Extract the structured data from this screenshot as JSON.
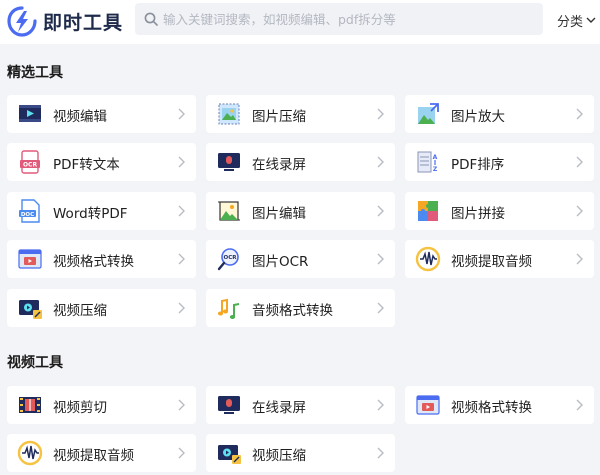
{
  "header": {
    "brand": "即时工具",
    "search_placeholder": "输入关键词搜索，如视频编辑、pdf拆分等",
    "category_label": "分类"
  },
  "sections": [
    {
      "title": "精选工具",
      "items": [
        {
          "label": "视频编辑",
          "icon": "video-edit-icon"
        },
        {
          "label": "图片压缩",
          "icon": "image-compress-icon"
        },
        {
          "label": "图片放大",
          "icon": "image-enlarge-icon"
        },
        {
          "label": "PDF转文本",
          "icon": "pdf-ocr-icon"
        },
        {
          "label": "在线录屏",
          "icon": "screen-record-icon"
        },
        {
          "label": "PDF排序",
          "icon": "pdf-sort-icon"
        },
        {
          "label": "Word转PDF",
          "icon": "doc-icon"
        },
        {
          "label": "图片编辑",
          "icon": "image-edit-icon"
        },
        {
          "label": "图片拼接",
          "icon": "puzzle-icon"
        },
        {
          "label": "视频格式转换",
          "icon": "video-convert-icon"
        },
        {
          "label": "图片OCR",
          "icon": "ocr-magnifier-icon"
        },
        {
          "label": "视频提取音频",
          "icon": "audio-wave-icon"
        },
        {
          "label": "视频压缩",
          "icon": "video-compress-icon"
        },
        {
          "label": "音频格式转换",
          "icon": "music-note-icon"
        }
      ]
    },
    {
      "title": "视频工具",
      "items": [
        {
          "label": "视频剪切",
          "icon": "film-cut-icon"
        },
        {
          "label": "在线录屏",
          "icon": "screen-record-icon"
        },
        {
          "label": "视频格式转换",
          "icon": "video-convert-icon"
        },
        {
          "label": "视频提取音频",
          "icon": "audio-wave-icon"
        },
        {
          "label": "视频压缩",
          "icon": "video-compress-icon"
        }
      ]
    }
  ],
  "colors": {
    "background": "#f3f4f7",
    "card": "#ffffff",
    "accent_blue": "#4b6cf0",
    "brand_text": "#1e2a4a"
  }
}
